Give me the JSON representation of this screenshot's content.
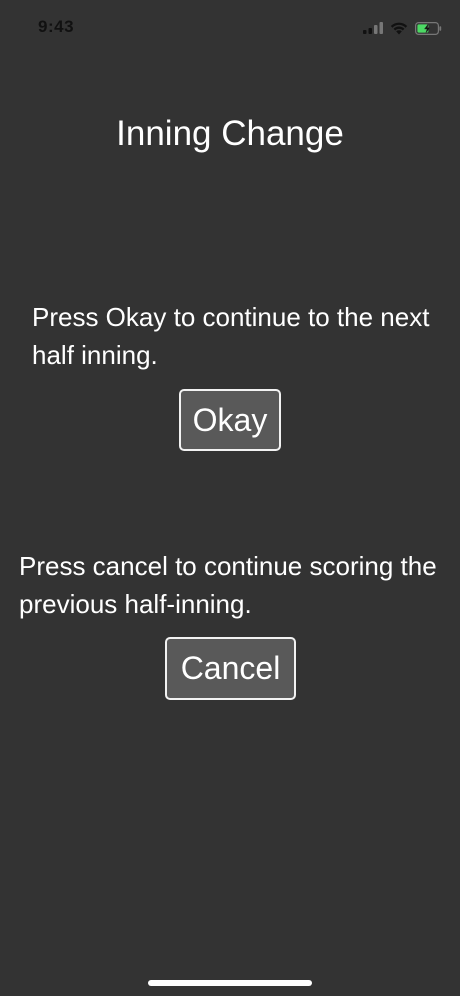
{
  "status_bar": {
    "time": "9:43",
    "icons": [
      "cellular-signal-icon",
      "wifi-icon",
      "battery-charging-icon"
    ],
    "battery_color": "#4cd964"
  },
  "screen": {
    "title": "Inning Change",
    "okay_message": "Press Okay to continue to the next half inning.",
    "okay_label": "Okay",
    "cancel_message": "Press cancel to continue scoring the previous half-inning.",
    "cancel_label": "Cancel"
  },
  "colors": {
    "background": "#333333",
    "button_fill": "#595959",
    "button_border": "#f2f2f2",
    "text": "#ffffff"
  }
}
